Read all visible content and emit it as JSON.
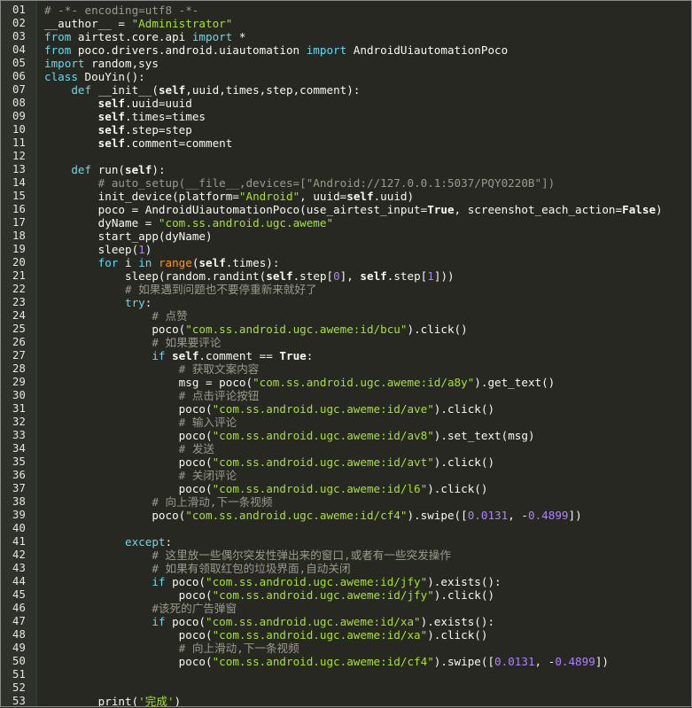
{
  "colors": {
    "background": "#272822",
    "gutter": "#2f312b",
    "comment": "#9a9a8c",
    "keyword": "#66d9ef",
    "string": "#a6e22e",
    "number": "#ae81ff",
    "builtin": "#fd971f",
    "plain": "#f8f8f2"
  },
  "lines": [
    {
      "n": "01",
      "tokens": [
        {
          "t": "# -*- encoding=utf8 -*-",
          "c": "cm"
        }
      ]
    },
    {
      "n": "02",
      "tokens": [
        {
          "t": "__author__ ",
          "c": "pl"
        },
        {
          "t": "= ",
          "c": "pl"
        },
        {
          "t": "\"Administrator\"",
          "c": "st"
        }
      ]
    },
    {
      "n": "03",
      "tokens": [
        {
          "t": "from ",
          "c": "kw"
        },
        {
          "t": "airtest.core.api ",
          "c": "pl"
        },
        {
          "t": "import ",
          "c": "kw"
        },
        {
          "t": "*",
          "c": "pl"
        }
      ]
    },
    {
      "n": "04",
      "tokens": [
        {
          "t": "from ",
          "c": "kw"
        },
        {
          "t": "poco.drivers.android.uiautomation ",
          "c": "pl"
        },
        {
          "t": "import ",
          "c": "kw"
        },
        {
          "t": "AndroidUiautomationPoco",
          "c": "pl"
        }
      ]
    },
    {
      "n": "05",
      "tokens": [
        {
          "t": "import ",
          "c": "kw"
        },
        {
          "t": "random,sys",
          "c": "pl"
        }
      ]
    },
    {
      "n": "06",
      "tokens": [
        {
          "t": "class ",
          "c": "kw"
        },
        {
          "t": "DouYin():",
          "c": "pl"
        }
      ]
    },
    {
      "n": "07",
      "tokens": [
        {
          "t": "    ",
          "c": "pl"
        },
        {
          "t": "def ",
          "c": "kw"
        },
        {
          "t": "__init__(",
          "c": "pl"
        },
        {
          "t": "self",
          "c": "self"
        },
        {
          "t": ",uuid,times,step,comment):",
          "c": "pl"
        }
      ]
    },
    {
      "n": "08",
      "tokens": [
        {
          "t": "        ",
          "c": "pl"
        },
        {
          "t": "self",
          "c": "self"
        },
        {
          "t": ".uuid=uuid",
          "c": "pl"
        }
      ]
    },
    {
      "n": "09",
      "tokens": [
        {
          "t": "        ",
          "c": "pl"
        },
        {
          "t": "self",
          "c": "self"
        },
        {
          "t": ".times=times",
          "c": "pl"
        }
      ]
    },
    {
      "n": "10",
      "tokens": [
        {
          "t": "        ",
          "c": "pl"
        },
        {
          "t": "self",
          "c": "self"
        },
        {
          "t": ".step=step",
          "c": "pl"
        }
      ]
    },
    {
      "n": "11",
      "tokens": [
        {
          "t": "        ",
          "c": "pl"
        },
        {
          "t": "self",
          "c": "self"
        },
        {
          "t": ".comment=comment",
          "c": "pl"
        }
      ]
    },
    {
      "n": "12",
      "tokens": []
    },
    {
      "n": "13",
      "tokens": [
        {
          "t": "    ",
          "c": "pl"
        },
        {
          "t": "def ",
          "c": "kw"
        },
        {
          "t": "run(",
          "c": "pl"
        },
        {
          "t": "self",
          "c": "self"
        },
        {
          "t": "):",
          "c": "pl"
        }
      ]
    },
    {
      "n": "14",
      "tokens": [
        {
          "t": "        ",
          "c": "pl"
        },
        {
          "t": "# auto_setup(__file__,devices=[\"Android://127.0.0.1:5037/PQY0220B\"])",
          "c": "cm"
        }
      ]
    },
    {
      "n": "15",
      "tokens": [
        {
          "t": "        ",
          "c": "pl"
        },
        {
          "t": "init_device(platform=",
          "c": "pl"
        },
        {
          "t": "\"Android\"",
          "c": "st"
        },
        {
          "t": ", uuid=",
          "c": "pl"
        },
        {
          "t": "self",
          "c": "self"
        },
        {
          "t": ".uuid)",
          "c": "pl"
        }
      ]
    },
    {
      "n": "16",
      "tokens": [
        {
          "t": "        ",
          "c": "pl"
        },
        {
          "t": "poco = AndroidUiautomationPoco(use_airtest_input=",
          "c": "pl"
        },
        {
          "t": "True",
          "c": "bold"
        },
        {
          "t": ", screenshot_each_action=",
          "c": "pl"
        },
        {
          "t": "False",
          "c": "bold"
        },
        {
          "t": ")",
          "c": "pl"
        }
      ]
    },
    {
      "n": "17",
      "tokens": [
        {
          "t": "        ",
          "c": "pl"
        },
        {
          "t": "dyName = ",
          "c": "pl"
        },
        {
          "t": "\"com.ss.android.ugc.aweme\"",
          "c": "st"
        }
      ]
    },
    {
      "n": "18",
      "tokens": [
        {
          "t": "        ",
          "c": "pl"
        },
        {
          "t": "start_app(dyName)",
          "c": "pl"
        }
      ]
    },
    {
      "n": "19",
      "tokens": [
        {
          "t": "        ",
          "c": "pl"
        },
        {
          "t": "sleep(",
          "c": "pl"
        },
        {
          "t": "1",
          "c": "nm"
        },
        {
          "t": ")",
          "c": "pl"
        }
      ]
    },
    {
      "n": "20",
      "tokens": [
        {
          "t": "        ",
          "c": "pl"
        },
        {
          "t": "for ",
          "c": "kw"
        },
        {
          "t": "i ",
          "c": "pl"
        },
        {
          "t": "in ",
          "c": "kw"
        },
        {
          "t": "range",
          "c": "bi"
        },
        {
          "t": "(",
          "c": "pl"
        },
        {
          "t": "self",
          "c": "self"
        },
        {
          "t": ".times):",
          "c": "pl"
        }
      ]
    },
    {
      "n": "21",
      "tokens": [
        {
          "t": "            ",
          "c": "pl"
        },
        {
          "t": "sleep(random.randint(",
          "c": "pl"
        },
        {
          "t": "self",
          "c": "self"
        },
        {
          "t": ".step[",
          "c": "pl"
        },
        {
          "t": "0",
          "c": "nm"
        },
        {
          "t": "], ",
          "c": "pl"
        },
        {
          "t": "self",
          "c": "self"
        },
        {
          "t": ".step[",
          "c": "pl"
        },
        {
          "t": "1",
          "c": "nm"
        },
        {
          "t": "]))",
          "c": "pl"
        }
      ]
    },
    {
      "n": "22",
      "tokens": [
        {
          "t": "            ",
          "c": "pl"
        },
        {
          "t": "# 如果遇到问题也不要停重新来就好了",
          "c": "cm"
        }
      ]
    },
    {
      "n": "23",
      "tokens": [
        {
          "t": "            ",
          "c": "pl"
        },
        {
          "t": "try",
          "c": "kw"
        },
        {
          "t": ":",
          "c": "pl"
        }
      ]
    },
    {
      "n": "24",
      "tokens": [
        {
          "t": "                ",
          "c": "pl"
        },
        {
          "t": "# 点赞",
          "c": "cm"
        }
      ]
    },
    {
      "n": "25",
      "tokens": [
        {
          "t": "                ",
          "c": "pl"
        },
        {
          "t": "poco(",
          "c": "pl"
        },
        {
          "t": "\"com.ss.android.ugc.aweme:id/bcu\"",
          "c": "st"
        },
        {
          "t": ").click()",
          "c": "pl"
        }
      ]
    },
    {
      "n": "26",
      "tokens": [
        {
          "t": "                ",
          "c": "pl"
        },
        {
          "t": "# 如果要评论",
          "c": "cm"
        }
      ]
    },
    {
      "n": "27",
      "tokens": [
        {
          "t": "                ",
          "c": "pl"
        },
        {
          "t": "if ",
          "c": "kw"
        },
        {
          "t": "self",
          "c": "self"
        },
        {
          "t": ".comment ",
          "c": "pl"
        },
        {
          "t": "== ",
          "c": "pl"
        },
        {
          "t": "True",
          "c": "bold"
        },
        {
          "t": ":",
          "c": "pl"
        }
      ]
    },
    {
      "n": "28",
      "tokens": [
        {
          "t": "                    ",
          "c": "pl"
        },
        {
          "t": "# 获取文案内容",
          "c": "cm"
        }
      ]
    },
    {
      "n": "29",
      "tokens": [
        {
          "t": "                    ",
          "c": "pl"
        },
        {
          "t": "msg = poco(",
          "c": "pl"
        },
        {
          "t": "\"com.ss.android.ugc.aweme:id/a8y\"",
          "c": "st"
        },
        {
          "t": ").get_text()",
          "c": "pl"
        }
      ]
    },
    {
      "n": "30",
      "tokens": [
        {
          "t": "                    ",
          "c": "pl"
        },
        {
          "t": "# 点击评论按钮",
          "c": "cm"
        }
      ]
    },
    {
      "n": "31",
      "tokens": [
        {
          "t": "                    ",
          "c": "pl"
        },
        {
          "t": "poco(",
          "c": "pl"
        },
        {
          "t": "\"com.ss.android.ugc.aweme:id/ave\"",
          "c": "st"
        },
        {
          "t": ").click()",
          "c": "pl"
        }
      ]
    },
    {
      "n": "32",
      "tokens": [
        {
          "t": "                    ",
          "c": "pl"
        },
        {
          "t": "# 输入评论",
          "c": "cm"
        }
      ]
    },
    {
      "n": "33",
      "tokens": [
        {
          "t": "                    ",
          "c": "pl"
        },
        {
          "t": "poco(",
          "c": "pl"
        },
        {
          "t": "\"com.ss.android.ugc.aweme:id/av8\"",
          "c": "st"
        },
        {
          "t": ").set_text(msg)",
          "c": "pl"
        }
      ]
    },
    {
      "n": "34",
      "tokens": [
        {
          "t": "                    ",
          "c": "pl"
        },
        {
          "t": "# 发送",
          "c": "cm"
        }
      ]
    },
    {
      "n": "35",
      "tokens": [
        {
          "t": "                    ",
          "c": "pl"
        },
        {
          "t": "poco(",
          "c": "pl"
        },
        {
          "t": "\"com.ss.android.ugc.aweme:id/avt\"",
          "c": "st"
        },
        {
          "t": ").click()",
          "c": "pl"
        }
      ]
    },
    {
      "n": "36",
      "tokens": [
        {
          "t": "                    ",
          "c": "pl"
        },
        {
          "t": "# 关闭评论",
          "c": "cm"
        }
      ]
    },
    {
      "n": "37",
      "tokens": [
        {
          "t": "                    ",
          "c": "pl"
        },
        {
          "t": "poco(",
          "c": "pl"
        },
        {
          "t": "\"com.ss.android.ugc.aweme:id/l6\"",
          "c": "st"
        },
        {
          "t": ").click()",
          "c": "pl"
        }
      ]
    },
    {
      "n": "38",
      "tokens": [
        {
          "t": "                ",
          "c": "pl"
        },
        {
          "t": "# 向上滑动,下一条视频",
          "c": "cm"
        }
      ]
    },
    {
      "n": "39",
      "tokens": [
        {
          "t": "                ",
          "c": "pl"
        },
        {
          "t": "poco(",
          "c": "pl"
        },
        {
          "t": "\"com.ss.android.ugc.aweme:id/cf4\"",
          "c": "st"
        },
        {
          "t": ").swipe([",
          "c": "pl"
        },
        {
          "t": "0.0131",
          "c": "nm"
        },
        {
          "t": ", ",
          "c": "pl"
        },
        {
          "t": "-",
          "c": "pl"
        },
        {
          "t": "0.4899",
          "c": "nm"
        },
        {
          "t": "])",
          "c": "pl"
        }
      ]
    },
    {
      "n": "40",
      "tokens": []
    },
    {
      "n": "41",
      "tokens": [
        {
          "t": "            ",
          "c": "pl"
        },
        {
          "t": "except",
          "c": "kw"
        },
        {
          "t": ":",
          "c": "pl"
        }
      ]
    },
    {
      "n": "42",
      "tokens": [
        {
          "t": "                ",
          "c": "pl"
        },
        {
          "t": "# 这里放一些偶尔突发性弹出来的窗口,或者有一些突发操作",
          "c": "cm"
        }
      ]
    },
    {
      "n": "43",
      "tokens": [
        {
          "t": "                ",
          "c": "pl"
        },
        {
          "t": "# 如果有领取红包的垃圾界面,自动关闭",
          "c": "cm"
        }
      ]
    },
    {
      "n": "44",
      "tokens": [
        {
          "t": "                ",
          "c": "pl"
        },
        {
          "t": "if ",
          "c": "kw"
        },
        {
          "t": "poco(",
          "c": "pl"
        },
        {
          "t": "\"com.ss.android.ugc.aweme:id/jfy\"",
          "c": "st"
        },
        {
          "t": ").exists():",
          "c": "pl"
        }
      ]
    },
    {
      "n": "45",
      "tokens": [
        {
          "t": "                    ",
          "c": "pl"
        },
        {
          "t": "poco(",
          "c": "pl"
        },
        {
          "t": "\"com.ss.android.ugc.aweme:id/jfy\"",
          "c": "st"
        },
        {
          "t": ").click()",
          "c": "pl"
        }
      ]
    },
    {
      "n": "46",
      "tokens": [
        {
          "t": "                ",
          "c": "pl"
        },
        {
          "t": "#该死的广告弹窗",
          "c": "cm"
        }
      ]
    },
    {
      "n": "47",
      "tokens": [
        {
          "t": "                ",
          "c": "pl"
        },
        {
          "t": "if ",
          "c": "kw"
        },
        {
          "t": "poco(",
          "c": "pl"
        },
        {
          "t": "\"com.ss.android.ugc.aweme:id/xa\"",
          "c": "st"
        },
        {
          "t": ").exists():",
          "c": "pl"
        }
      ]
    },
    {
      "n": "48",
      "tokens": [
        {
          "t": "                    ",
          "c": "pl"
        },
        {
          "t": "poco(",
          "c": "pl"
        },
        {
          "t": "\"com.ss.android.ugc.aweme:id/xa\"",
          "c": "st"
        },
        {
          "t": ").click()",
          "c": "pl"
        }
      ]
    },
    {
      "n": "49",
      "tokens": [
        {
          "t": "                    ",
          "c": "pl"
        },
        {
          "t": "# 向上滑动,下一条视频",
          "c": "cm"
        }
      ]
    },
    {
      "n": "50",
      "tokens": [
        {
          "t": "                    ",
          "c": "pl"
        },
        {
          "t": "poco(",
          "c": "pl"
        },
        {
          "t": "\"com.ss.android.ugc.aweme:id/cf4\"",
          "c": "st"
        },
        {
          "t": ").swipe([",
          "c": "pl"
        },
        {
          "t": "0.0131",
          "c": "nm"
        },
        {
          "t": ", ",
          "c": "pl"
        },
        {
          "t": "-",
          "c": "pl"
        },
        {
          "t": "0.4899",
          "c": "nm"
        },
        {
          "t": "])",
          "c": "pl"
        }
      ]
    },
    {
      "n": "51",
      "tokens": []
    },
    {
      "n": "52",
      "tokens": []
    },
    {
      "n": "53",
      "tokens": [
        {
          "t": "        ",
          "c": "pl"
        },
        {
          "t": "print(",
          "c": "pl"
        },
        {
          "t": "'完成'",
          "c": "st"
        },
        {
          "t": ")",
          "c": "pl"
        }
      ]
    }
  ]
}
